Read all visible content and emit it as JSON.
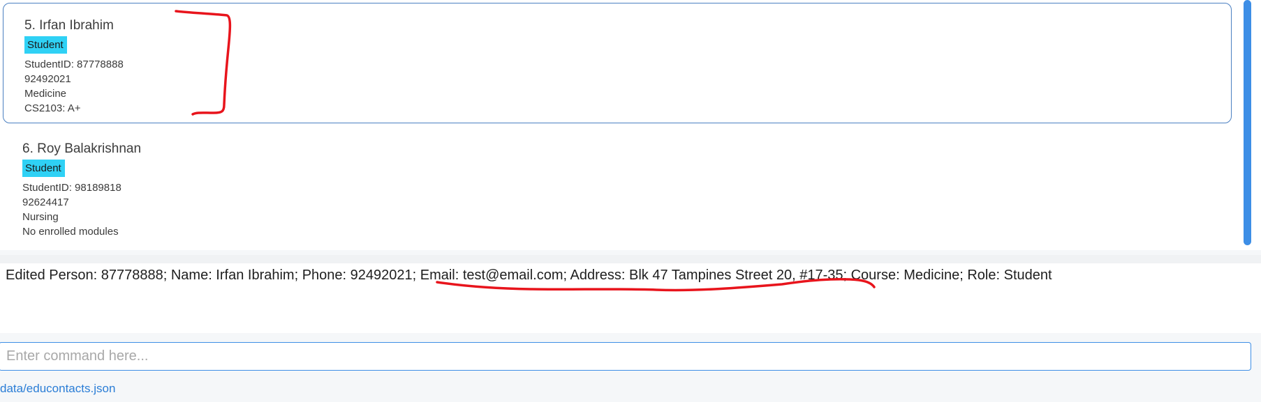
{
  "person_list": {
    "cards": [
      {
        "name": "5. Irfan Ibrahim",
        "tag": "Student",
        "student_id": "StudentID: 87778888",
        "phone": "92492021",
        "course": "Medicine",
        "modules": "CS2103: A+"
      },
      {
        "name": "6. Roy Balakrishnan",
        "tag": "Student",
        "student_id": "StudentID: 98189818",
        "phone": "92624417",
        "course": "Nursing",
        "modules": "No enrolled modules"
      }
    ]
  },
  "result_display": {
    "message": "Edited Person: 87778888; Name: Irfan Ibrahim; Phone: 92492021; Email: test@email.com; Address: Blk 47 Tampines Street 20, #17-35; Course: Medicine; Role: Student"
  },
  "command_box": {
    "value": "",
    "placeholder": "Enter command here..."
  },
  "status_bar": {
    "file_path": "data/educontacts.json"
  },
  "colors": {
    "tag_background": "#2fd1f5",
    "accent": "#3d8ee6",
    "annotation": "#e8141c"
  }
}
